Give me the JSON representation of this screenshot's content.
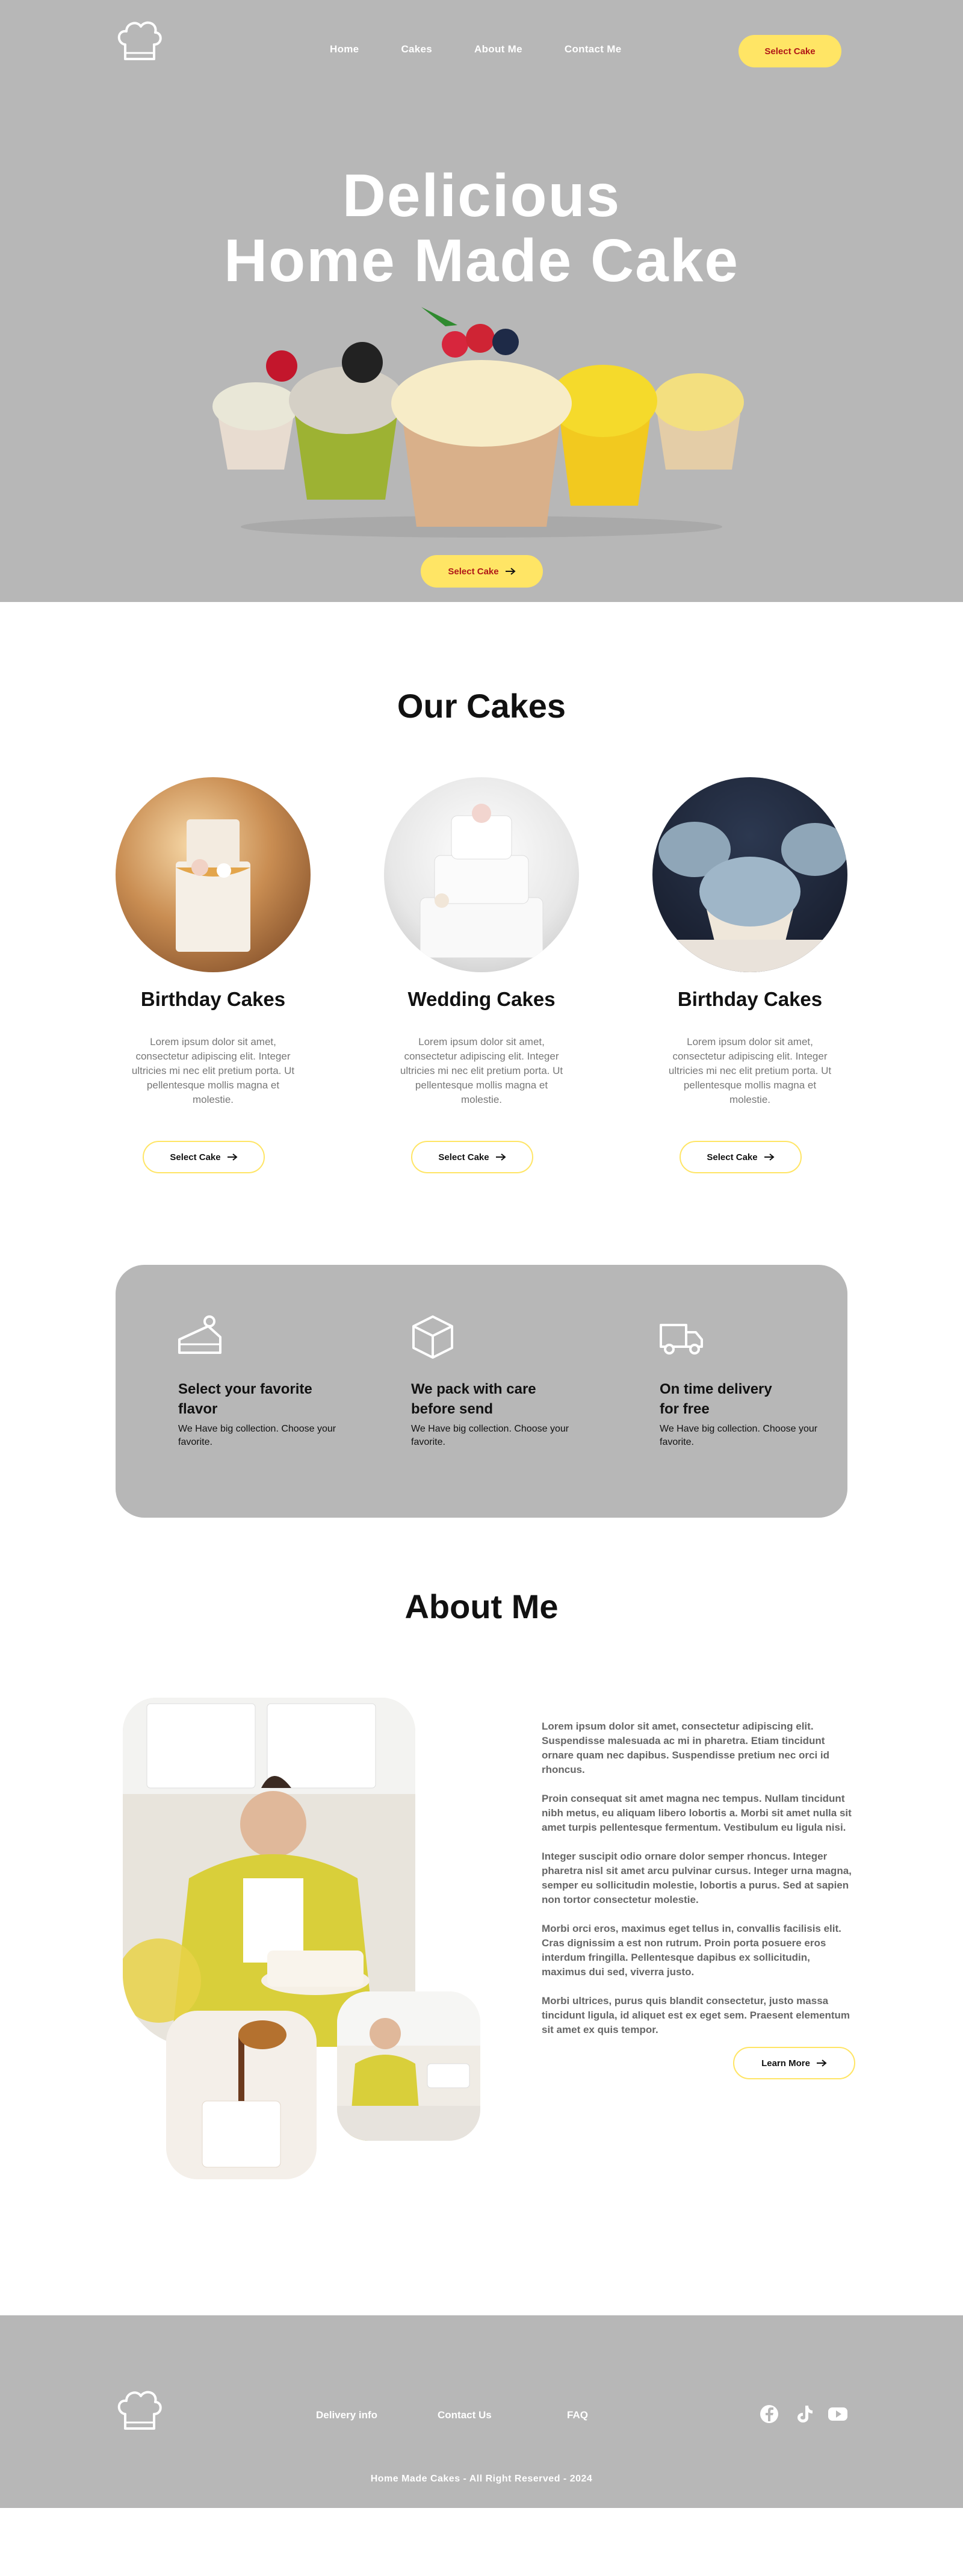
{
  "header": {
    "logo_icon": "chef-hat-icon",
    "nav": [
      "Home",
      "Cakes",
      "About Me",
      "Contact Me"
    ],
    "cta_label": "Select Cake"
  },
  "hero": {
    "title_line1": "Delicious",
    "title_line2": "Home Made Cake",
    "image": "cupcakes-photo",
    "cta_label": "Select Cake",
    "cta_icon": "arrow-right-icon"
  },
  "our_cakes": {
    "title": "Our Cakes",
    "items": [
      {
        "name": "Birthday Cakes",
        "desc": "Lorem ipsum dolor sit amet, consectetur adipiscing elit. Integer ultricies mi nec elit pretium porta. Ut pellentesque mollis magna et molestie.",
        "button": "Select Cake"
      },
      {
        "name": "Wedding Cakes",
        "desc": "Lorem ipsum dolor sit amet, consectetur adipiscing elit. Integer ultricies mi nec elit pretium porta. Ut pellentesque mollis magna et molestie.",
        "button": "Select Cake"
      },
      {
        "name": "Birthday Cakes",
        "desc": "Lorem ipsum dolor sit amet, consectetur adipiscing elit. Integer ultricies mi nec elit pretium porta. Ut pellentesque mollis magna et molestie.",
        "button": "Select Cake"
      }
    ]
  },
  "features": [
    {
      "icon": "cake-slice-icon",
      "title_line1": "Select your favorite",
      "title_line2": "flavor",
      "text": "We Have big collection. Choose your favorite."
    },
    {
      "icon": "box-icon",
      "title_line1": "We pack with care",
      "title_line2": "before send",
      "text": "We Have big collection. Choose your favorite."
    },
    {
      "icon": "delivery-truck-icon",
      "title_line1": "On time delivery",
      "title_line2": "for free",
      "text": "We Have big collection. Choose your favorite."
    }
  ],
  "about": {
    "title": "About Me",
    "paragraphs": [
      "Lorem ipsum dolor sit amet, consectetur adipiscing elit. Suspendisse malesuada ac mi in pharetra. Etiam tincidunt ornare quam nec dapibus. Suspendisse pretium nec orci id rhoncus.",
      "Proin consequat sit amet magna nec tempus. Nullam tincidunt nibh metus, eu aliquam libero lobortis a. Morbi sit amet nulla sit amet turpis pellentesque fermentum. Vestibulum eu ligula nisi.",
      "Integer suscipit odio ornare dolor semper rhoncus. Integer pharetra nisl sit amet arcu pulvinar cursus. Integer urna magna, semper eu sollicitudin molestie, lobortis a purus. Sed at sapien non tortor consectetur molestie.",
      "Morbi orci eros, maximus eget tellus in, convallis facilisis elit. Cras dignissim a est non rutrum. Proin porta posuere eros interdum fringilla. Pellentesque dapibus ex sollicitudin, maximus dui sed, viverra justo.",
      "Morbi ultrices, purus quis blandit consectetur, justo massa tincidunt ligula, id aliquet est ex eget sem. Praesent elementum sit amet ex quis tempor."
    ],
    "button": "Learn More"
  },
  "footer": {
    "links": [
      "Delivery info",
      "Contact Us",
      "FAQ"
    ],
    "social": [
      "facebook-icon",
      "tiktok-icon",
      "youtube-icon"
    ],
    "copyright": "Home Made Cakes - All Right Reserved - 2024"
  },
  "colors": {
    "accent": "#ffe565",
    "hero_bg": "#b7b7b7",
    "cta_text": "#b01717"
  }
}
